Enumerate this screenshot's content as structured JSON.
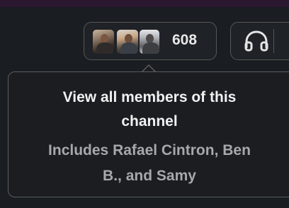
{
  "channel_header": {
    "member_count": "608",
    "avatars": [
      {
        "name": "member-avatar-1"
      },
      {
        "name": "member-avatar-2"
      },
      {
        "name": "member-avatar-3"
      }
    ]
  },
  "huddle": {
    "icon": "headphones-icon"
  },
  "tooltip": {
    "title_line_1": "View all members of this",
    "title_line_2": "channel",
    "subtitle_line_1": "Includes Rafael Cintron, Ben",
    "subtitle_line_2": "B., and Samy"
  },
  "colors": {
    "background": "#1a1d21",
    "border": "#565856",
    "text_primary": "#f1f1f1",
    "text_secondary": "#a7a8aa",
    "top_strip": "#2b1730"
  }
}
